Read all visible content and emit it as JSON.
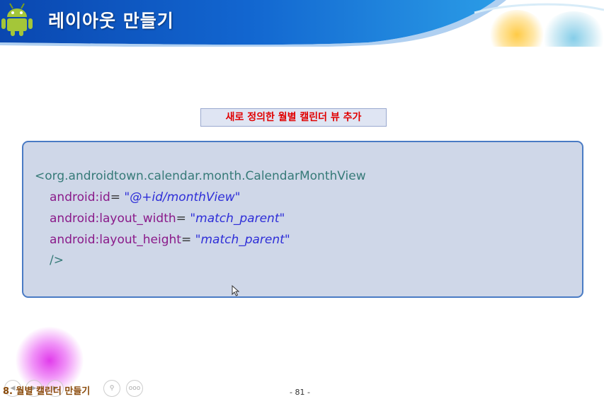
{
  "header": {
    "title": "레이아웃 만들기",
    "logo_icon": "android-robot-icon"
  },
  "caption": "새로 정의한 월별 캘린더 뷰 추가",
  "code": {
    "open_tag": "<org.androidtown.calendar.month.CalendarMonthView",
    "lines": [
      {
        "attr": "android:id",
        "eq": "=",
        "value": "\"@+id/monthView\""
      },
      {
        "attr": "android:layout_width",
        "eq": "=",
        "value": "\"match_parent\""
      },
      {
        "attr": "android:layout_height",
        "eq": "=",
        "value": "\"match_parent\""
      }
    ],
    "close_tag": "/>"
  },
  "footer": {
    "chapter": "8. 월별 캘린더 만들기",
    "page": "- 81 -",
    "nav_icons": [
      "prev-icon",
      "play-icon",
      "next-icon",
      "zoom-icon",
      "more-icon"
    ],
    "more_label": "ooo"
  },
  "colors": {
    "header_blue": "#1560c8",
    "caption_red": "#e00000",
    "code_bg": "#cfd7e8",
    "code_border": "#4a7bc4",
    "tag_teal": "#367a78",
    "attr_purple": "#8a1a8a",
    "value_blue": "#2e2ed8"
  }
}
